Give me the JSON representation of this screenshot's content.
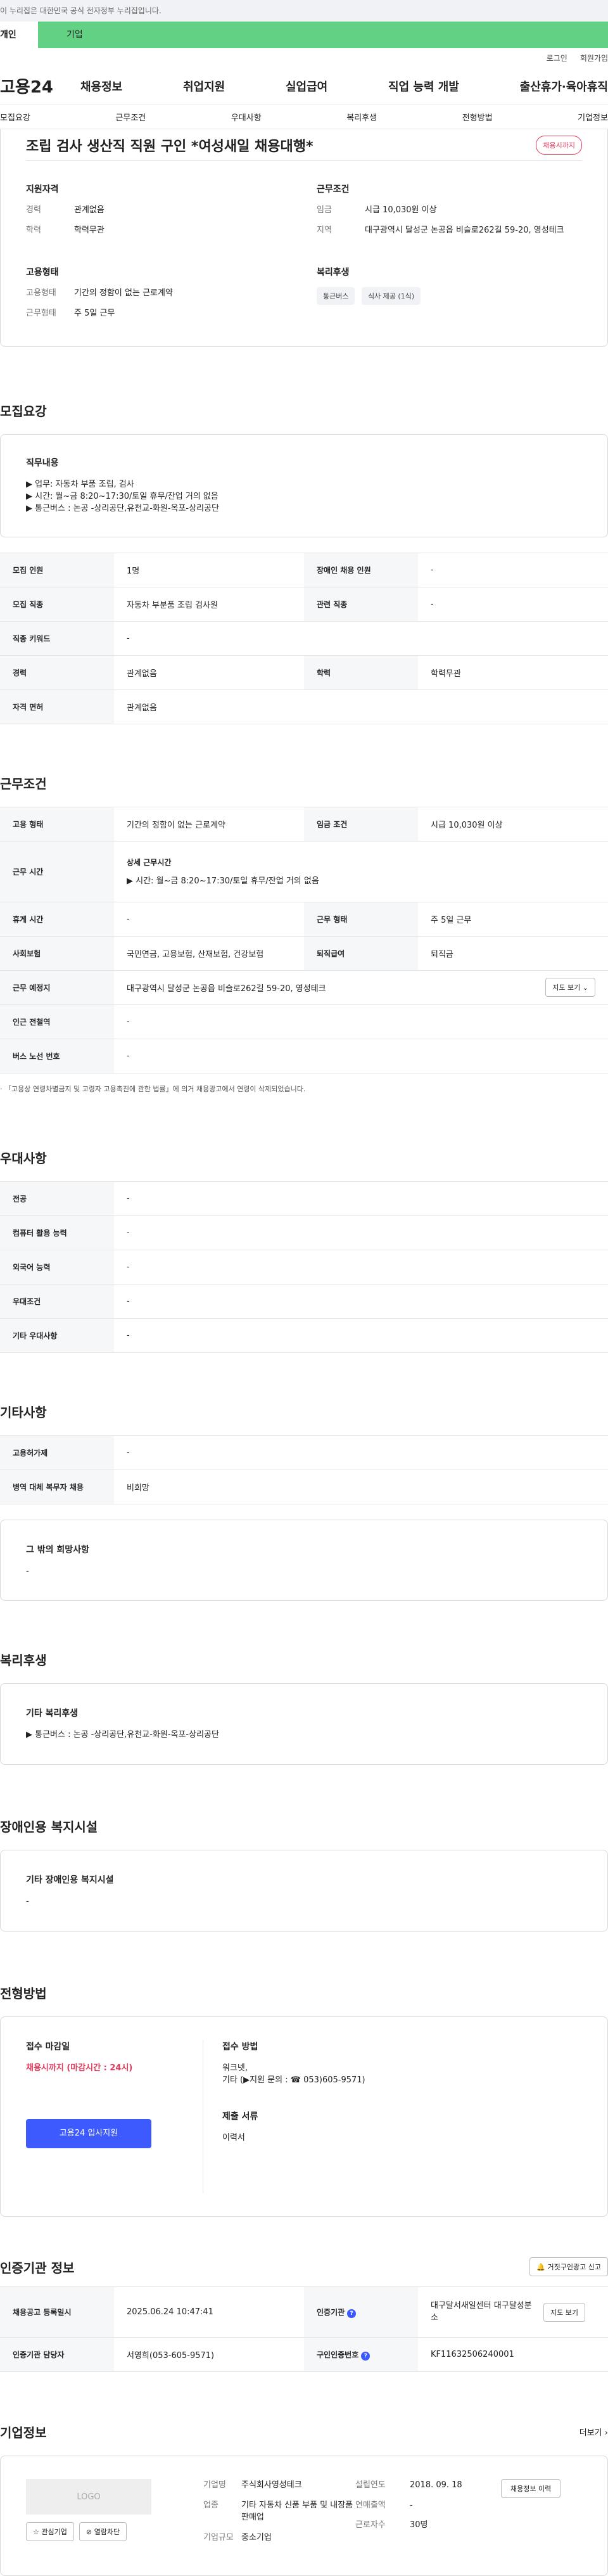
{
  "gov_banner": "이 누리집은 대한민국 공식 전자정부 누리집입니다.",
  "tabs": {
    "personal": "개인",
    "company": "기업"
  },
  "util": {
    "login": "로그인",
    "join": "회원가입"
  },
  "logo": "고용24",
  "gnb": [
    "채용정보",
    "취업지원",
    "실업급여",
    "직업 능력 개발",
    "출산휴가·육아휴직"
  ],
  "subnav": [
    "모집요강",
    "근무조건",
    "우대사항",
    "복리후생",
    "전형방법",
    "기업정보"
  ],
  "hero": {
    "title": "조립 검사 생산직 직원 구인 *여성새일 채용대행*",
    "deadline_badge": "채용시까지",
    "qual_title": "지원자격",
    "career_k": "경력",
    "career_v": "관계없음",
    "edu_k": "학력",
    "edu_v": "학력무관",
    "cond_title": "근무조건",
    "wage_k": "임금",
    "wage_v": "시급 10,030원 이상",
    "area_k": "지역",
    "area_v": "대구광역시 달성군 논공읍 비슬로262길 59-20, 영성테크",
    "emp_title": "고용형태",
    "emptype_k": "고용형태",
    "emptype_v": "기간의 정함이 없는 근로계약",
    "worktype_k": "근무형태",
    "worktype_v": "주 5일 근무",
    "welfare_title": "복리후생",
    "chips": [
      "통근버스",
      "식사 제공 (1식)"
    ]
  },
  "recruit": {
    "title": "모집요강",
    "duty_title": "직무내용",
    "duty_lines": [
      "▶ 업무: 자동차 부품 조립, 검사",
      "▶ 시간: 월~금 8:20~17:30/토일 휴무/잔업 거의 없음",
      "▶ 통근버스 : 논공 -상리공단,유천교-화원-옥포-상리공단"
    ],
    "headcount_k": "모집 인원",
    "headcount_v": "1명",
    "disabled_k": "장애인 채용 인원",
    "disabled_v": "-",
    "job_k": "모집 직종",
    "job_v": "자동차 부분품 조립 검사원",
    "related_k": "관련 직종",
    "related_v": "-",
    "keyword_k": "직종 키워드",
    "keyword_v": "-",
    "career_k": "경력",
    "career_v": "관계없음",
    "edu_k": "학력",
    "edu_v": "학력무관",
    "license_k": "자격 면허",
    "license_v": "관계없음"
  },
  "conditions": {
    "title": "근무조건",
    "emp_k": "고용 형태",
    "emp_v": "기간의 정함이 없는 근로계약",
    "wage_k": "임금 조건",
    "wage_v": "시급 10,030원 이상",
    "hours_k": "근무 시간",
    "hours_sub": "상세 근무시간",
    "hours_v": "▶ 시간: 월~금 8:20~17:30/토일 휴무/잔업 거의 없음",
    "break_k": "휴게 시간",
    "break_v": "-",
    "worktype_k": "근무 형태",
    "worktype_v": "주 5일 근무",
    "insurance_k": "사회보험",
    "insurance_v": "국민연금, 고용보험, 산재보험, 건강보험",
    "retire_k": "퇴직급여",
    "retire_v": "퇴직금",
    "place_k": "근무 예정지",
    "place_v": "대구광역시 달성군 논공읍 비슬로262길 59-20, 영성테크",
    "map_btn": "지도 보기",
    "subway_k": "인근 전철역",
    "subway_v": "-",
    "bus_k": "버스 노선 번호",
    "bus_v": "-",
    "note": "「고용상 연령차별금지 및 고령자 고용촉진에 관한 법률」에 의거 채용광고에서 연령이 삭제되었습니다."
  },
  "pref": {
    "title": "우대사항",
    "rows": [
      [
        "전공",
        "-"
      ],
      [
        "컴퓨터 활용 능력",
        "-"
      ],
      [
        "외국어 능력",
        "-"
      ],
      [
        "우대조건",
        "-"
      ],
      [
        "기타 우대사항",
        "-"
      ]
    ]
  },
  "etc": {
    "title": "기타사항",
    "rows": [
      [
        "고용허가제",
        "-"
      ],
      [
        "병역 대체 복무자 채용",
        "비희망"
      ]
    ],
    "other_title": "그 밖의 희망사항",
    "other_v": "-"
  },
  "welfare": {
    "title": "복리후생",
    "box_title": "기타 복리후생",
    "box_v": "▶ 통근버스 : 논공 -상리공단,유천교-화원-옥포-상리공단"
  },
  "disabled_fac": {
    "title": "장애인용 복지시설",
    "box_title": "기타 장애인용 복지시설",
    "box_v": "-"
  },
  "selection": {
    "title": "전형방법",
    "deadline_title": "접수 마감일",
    "deadline_v": "채용시까지 (마감시간 : 24시)",
    "apply_btn": "고용24 입사지원",
    "method_title": "접수 방법",
    "method_v1": "워크넷,",
    "method_v2": "기타 (▶지원 문의 : ☎ 053)605-9571)",
    "docs_title": "제출 서류",
    "docs_v": "이력서"
  },
  "agency": {
    "title": "인증기관 정보",
    "report_btn": "거짓구인광고 신고",
    "reg_k": "채용공고 등록일시",
    "reg_v": "2025.06.24 10:47:41",
    "org_k": "인증기관",
    "org_v": "대구달서새일센터 대구달성분소",
    "org_btn": "지도 보기",
    "mgr_k": "인증기관 담당자",
    "mgr_v": "서영희(053-605-9571)",
    "num_k": "구인인증번호",
    "num_v": "KF11632506240001"
  },
  "company": {
    "title": "기업정보",
    "more": "더보기",
    "logo_text": "LOGO",
    "fav_btn": "관심기업",
    "block_btn": "열람차단",
    "name_k": "기업명",
    "name_v": "주식회사영성테크",
    "biz_k": "업종",
    "biz_v": "기타 자동차 신품 부품 및 내장품 판매업",
    "size_k": "기업규모",
    "size_v": "중소기업",
    "founded_k": "설립연도",
    "founded_v": "2018. 09. 18",
    "sales_k": "연매출액",
    "sales_v": "-",
    "emp_k": "근로자수",
    "emp_v": "30명",
    "hist_btn": "채용정보 이력"
  }
}
